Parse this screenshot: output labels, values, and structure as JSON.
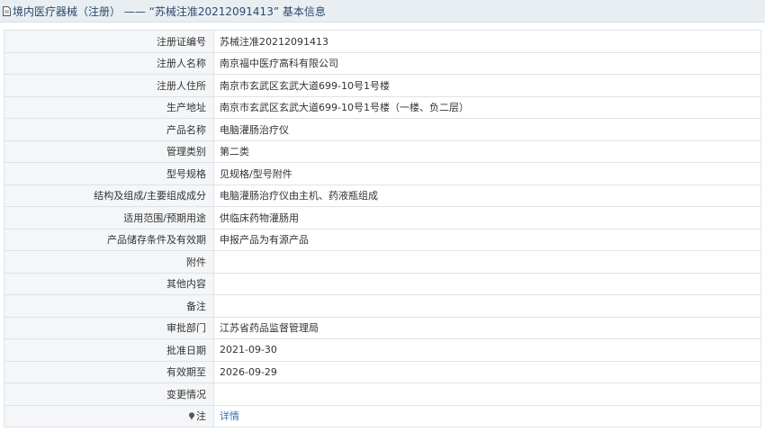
{
  "header": {
    "title": "境内医疗器械（注册） —— “苏械注准20212091413” 基本信息"
  },
  "rows": [
    {
      "label": "注册证编号",
      "value": "苏械注准20212091413"
    },
    {
      "label": "注册人名称",
      "value": "南京福中医疗高科有限公司"
    },
    {
      "label": "注册人住所",
      "value": "南京市玄武区玄武大道699-10号1号楼"
    },
    {
      "label": "生产地址",
      "value": "南京市玄武区玄武大道699-10号1号楼（一楼、负二层）"
    },
    {
      "label": "产品名称",
      "value": "电脑灌肠治疗仪"
    },
    {
      "label": "管理类别",
      "value": "第二类"
    },
    {
      "label": "型号规格",
      "value": "见规格/型号附件"
    },
    {
      "label": "结构及组成/主要组成成分",
      "value": "电脑灌肠治疗仪由主机、药液瓶组成"
    },
    {
      "label": "适用范围/预期用途",
      "value": "供临床药物灌肠用"
    },
    {
      "label": "产品储存条件及有效期",
      "value": "申报产品为有源产品"
    },
    {
      "label": "附件",
      "value": ""
    },
    {
      "label": "其他内容",
      "value": ""
    },
    {
      "label": "备注",
      "value": ""
    },
    {
      "label": "审批部门",
      "value": "江苏省药品监督管理局"
    },
    {
      "label": "批准日期",
      "value": "2021-09-30"
    },
    {
      "label": "有效期至",
      "value": "2026-09-29"
    },
    {
      "label": "变更情况",
      "value": ""
    }
  ],
  "note": {
    "label": "注",
    "link": "详情",
    "icon": "pin-icon"
  },
  "colors": {
    "header_bg": "#e9eef3",
    "label_bg": "#f4f6f8",
    "link": "#2f6fb8",
    "border": "#dde3e9"
  }
}
